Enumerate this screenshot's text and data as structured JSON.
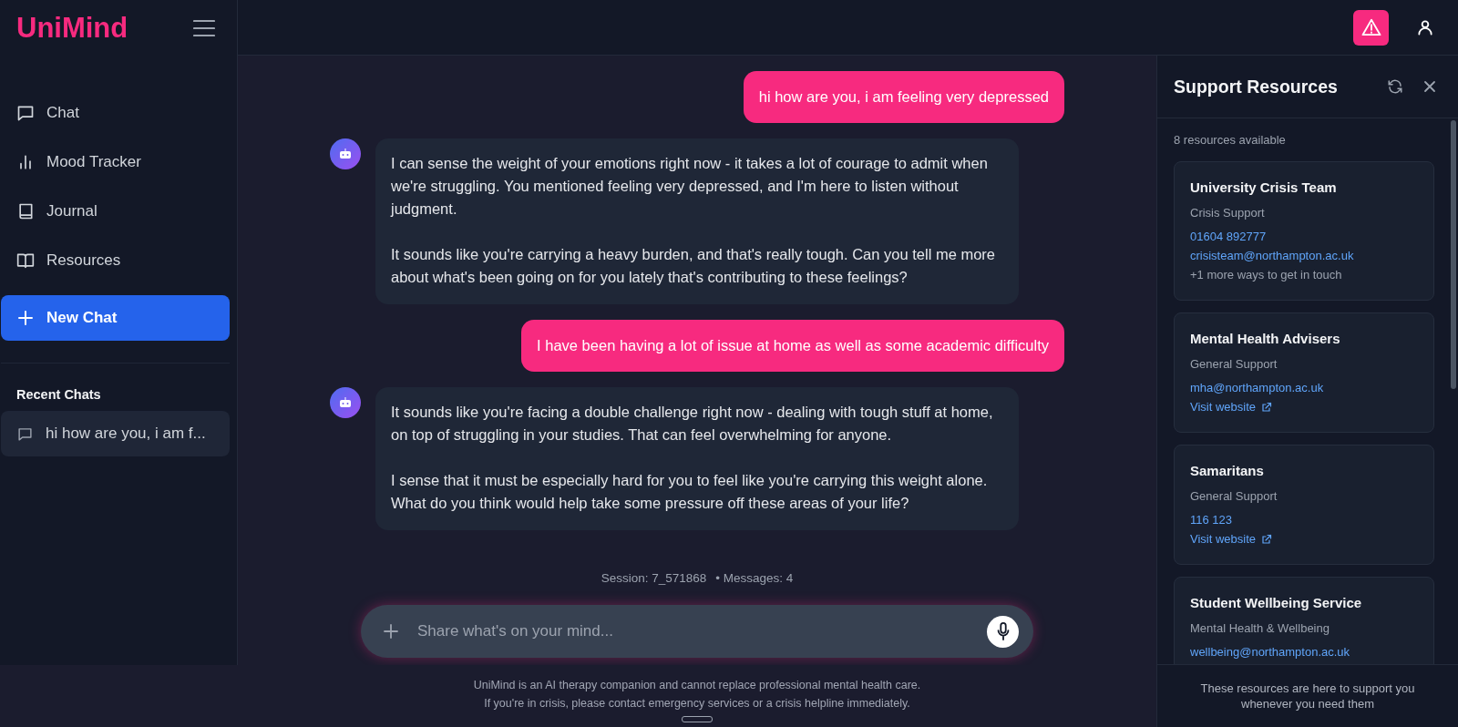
{
  "sidebar": {
    "logo": "UniMind",
    "nav": [
      {
        "kind": "chat",
        "label": "Chat"
      },
      {
        "kind": "chart",
        "label": "Mood Tracker"
      },
      {
        "kind": "book",
        "label": "Journal"
      },
      {
        "kind": "openbook",
        "label": "Resources"
      }
    ],
    "new_chat": "New Chat",
    "recent_heading": "Recent Chats",
    "recent": [
      {
        "title": "hi how are you, i am f..."
      }
    ]
  },
  "messages": [
    {
      "kind": "user",
      "paragraphs": [
        "hi how are you, i am feeling very depressed"
      ]
    },
    {
      "kind": "assistant",
      "paragraphs": [
        "I can sense the weight of your emotions right now - it takes a lot of courage to admit when we're struggling. You mentioned feeling very depressed, and I'm here to listen without judgment.",
        "It sounds like you're carrying a heavy burden, and that's really tough. Can you tell me more about what's been going on for you lately that's contributing to these feelings?"
      ]
    },
    {
      "kind": "user",
      "paragraphs": [
        "I have been having a lot of issue at home as well as some academic difficulty"
      ]
    },
    {
      "kind": "assistant",
      "paragraphs": [
        "It sounds like you're facing a double challenge right now - dealing with tough stuff at home, on top of struggling in your studies. That can feel overwhelming for anyone.",
        "I sense that it must be especially hard for you to feel like you're carrying this weight alone. What do you think would help take some pressure off these areas of your life?"
      ]
    }
  ],
  "session_info": "Session: 7_571868",
  "message_count": "• Messages: 4",
  "composer": {
    "placeholder": "Share what's on your mind..."
  },
  "disclaimer": [
    "UniMind is an AI therapy companion and cannot replace professional mental health care.",
    "If you're in crisis, please contact emergency services or a crisis helpline immediately."
  ],
  "resources": {
    "title": "Support Resources",
    "count": "8 resources available",
    "cards": [
      {
        "name": "University Crisis Team",
        "category": "Crisis Support",
        "contacts": [
          {
            "kind": "link",
            "text": "01604 892777"
          },
          {
            "kind": "link",
            "text": "crisisteam@northampton.ac.uk"
          },
          {
            "kind": "note",
            "text": "+1 more ways to get in touch"
          }
        ]
      },
      {
        "name": "Mental Health Advisers",
        "category": "General Support",
        "contacts": [
          {
            "kind": "link",
            "text": "mha@northampton.ac.uk"
          },
          {
            "kind": "website",
            "text": "Visit website"
          }
        ]
      },
      {
        "name": "Samaritans",
        "category": "General Support",
        "contacts": [
          {
            "kind": "link",
            "text": "116 123"
          },
          {
            "kind": "website",
            "text": "Visit website"
          }
        ]
      },
      {
        "name": "Student Wellbeing Service",
        "category": "Mental Health & Wellbeing",
        "contacts": [
          {
            "kind": "link",
            "text": "wellbeing@northampton.ac.uk"
          }
        ]
      }
    ],
    "footer": "These resources are here to support you whenever you need them"
  }
}
